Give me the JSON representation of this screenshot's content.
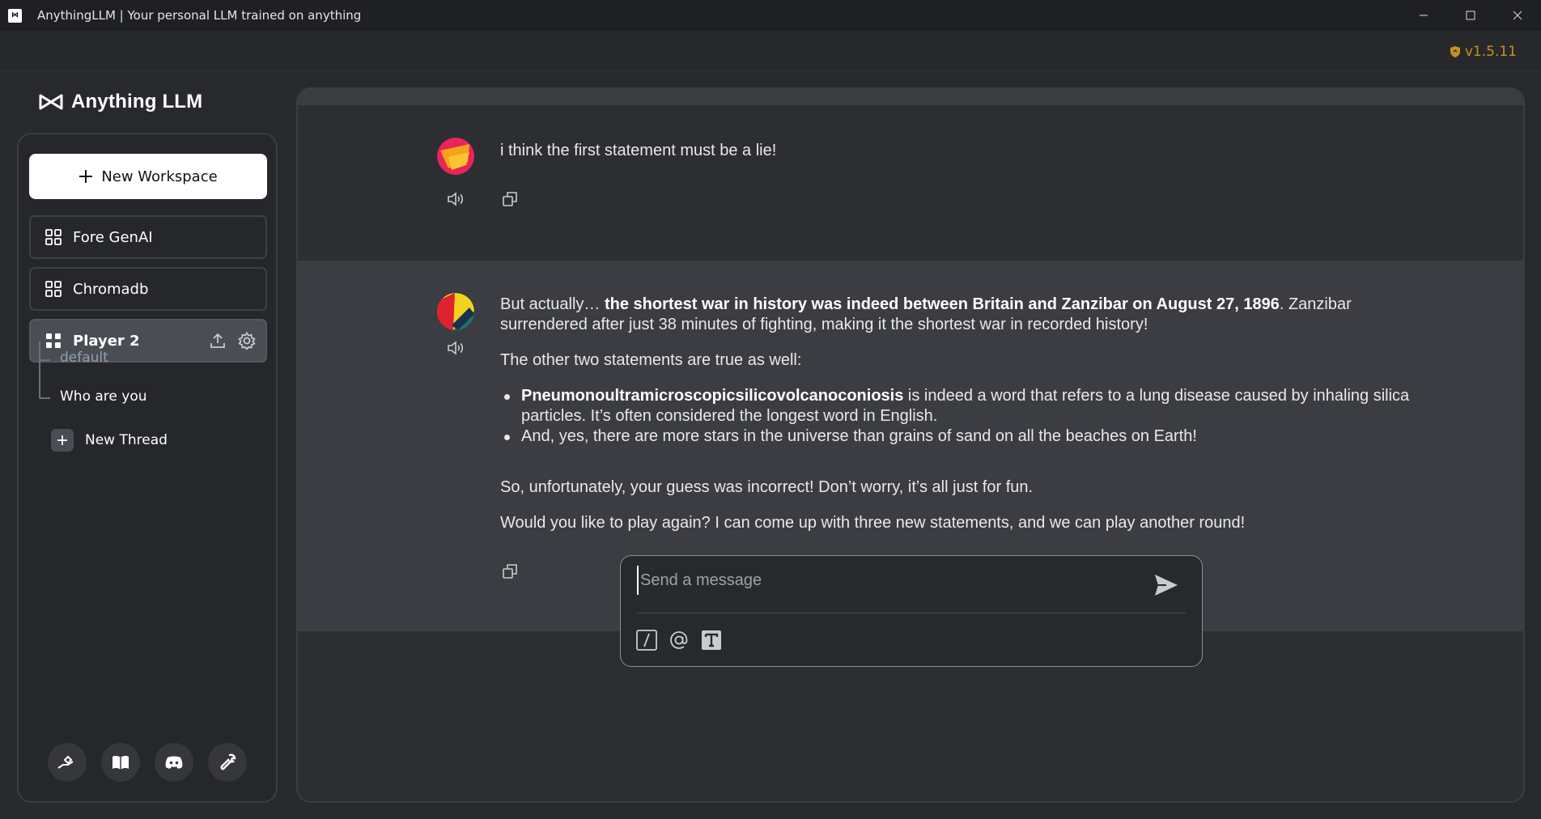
{
  "window": {
    "title": "AnythingLLM | Your personal LLM trained on anything",
    "app_icon_text": "⋈"
  },
  "header": {
    "version": "v1.5.11"
  },
  "sidebar": {
    "brand": "Anything LLM",
    "new_workspace_label": "New Workspace",
    "workspaces": [
      {
        "label": "Fore GenAI"
      },
      {
        "label": "Chromadb"
      },
      {
        "label": "Player 2",
        "active": true
      }
    ],
    "threads": [
      {
        "label": "default"
      },
      {
        "label": "Who are you",
        "active": true
      }
    ],
    "new_thread_label": "New Thread",
    "footer_icons": [
      "community-hub-icon",
      "docs-book-icon",
      "discord-icon",
      "settings-wrench-icon"
    ]
  },
  "chat": {
    "user_message": "i think the first statement must be a lie!",
    "assistant": {
      "p1_prefix": "But actually… ",
      "p1_bold": "the shortest war in history was indeed between Britain and Zanzibar on August 27, 1896",
      "p1_suffix": ". Zanzibar surrendered after just 38 minutes of fighting, making it the shortest war in recorded history!",
      "p2": "The other two statements are true as well:",
      "bullet1_bold": "Pneumonoultramicroscopicsilicovolcanoconiosis",
      "bullet1_rest": " is indeed a word that refers to a lung disease caused by inhaling silica particles. It’s often considered the longest word in English.",
      "bullet2": "And, yes, there are more stars in the universe than grains of sand on all the beaches on Earth!",
      "p3": "So, unfortunately, your guess was incorrect! Don’t worry, it’s all just for fun.",
      "p4": "Would you like to play again? I can come up with three new statements, and we can play another round!"
    }
  },
  "composer": {
    "placeholder": "Send a message",
    "value": ""
  },
  "colors": {
    "accent_version": "#c7901d",
    "background": "#27292d",
    "assistant_bg": "#3b3d42"
  }
}
